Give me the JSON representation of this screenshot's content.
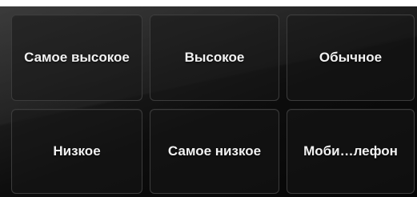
{
  "priority_options": [
    {
      "label": "Самое высокое"
    },
    {
      "label": "Высокое"
    },
    {
      "label": "Обычное"
    },
    {
      "label": "Низкое"
    },
    {
      "label": "Самое низкое"
    },
    {
      "label": "Моби…лефон"
    }
  ],
  "colors": {
    "panel_background": "#0d0d0d",
    "tile_border": "#3c3c3c",
    "label_text": "#f2f2f2"
  }
}
